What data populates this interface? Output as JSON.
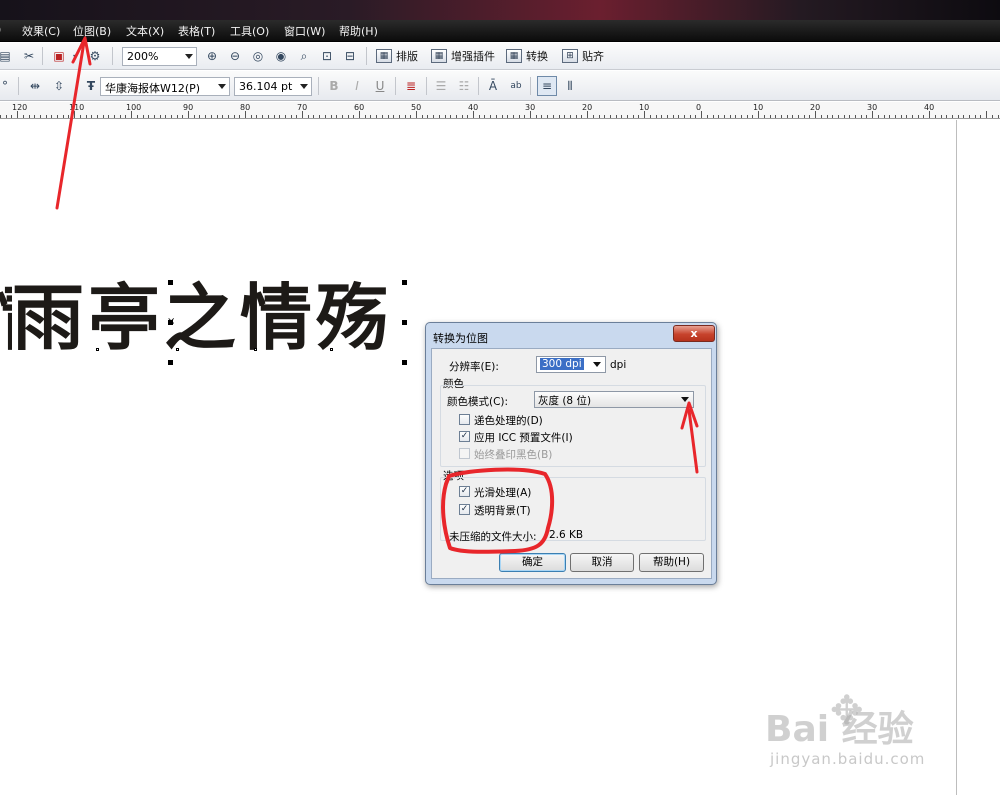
{
  "menu": {
    "items": [
      "效果(C)",
      "位图(B)",
      "文本(X)",
      "表格(T)",
      "工具(O)",
      "窗口(W)",
      "帮助(H)"
    ]
  },
  "toolbar": {
    "zoom": "200%",
    "buttons": [
      "排版",
      "增强插件",
      "转换",
      "贴齐"
    ]
  },
  "property_bar": {
    "font_name": "华康海报体W12(P)",
    "font_size": "36.104 pt"
  },
  "ruler": {
    "labels": [
      "120",
      "110",
      "100",
      "90",
      "80",
      "70",
      "60",
      "50",
      "40",
      "30",
      "20",
      "10",
      "0",
      "10",
      "20",
      "30",
      "40"
    ]
  },
  "canvas": {
    "art_text": "雨亭之情殇"
  },
  "dialog": {
    "title": "转换为位图",
    "close_label": "x",
    "resolution_label": "分辨率(E):",
    "resolution_value": "300 dpi",
    "resolution_unit": "dpi",
    "color_group": "颜色",
    "color_mode_label": "颜色模式(C):",
    "color_mode_value": "灰度 (8 位)",
    "dithered_label": "递色处理的(D)",
    "icc_label": "应用 ICC 预置文件(I)",
    "overprint_label": "始终叠印黑色(B)",
    "options_group": "选项",
    "antialias_label": "光滑处理(A)",
    "transparent_label": "透明背景(T)",
    "file_size_label": "未压缩的文件大小:",
    "file_size_value": "2.6 KB",
    "ok_label": "确定",
    "cancel_label": "取消",
    "help_label": "帮助(H)"
  },
  "watermark": {
    "brand": "Bai  经验",
    "url": "jingyan.baidu.com"
  },
  "colors": {
    "menubar_bg": "#111111",
    "dialog_frame": "#c9d9ee",
    "annotation_red": "#e8262b",
    "art_text": "#1d1a17"
  }
}
